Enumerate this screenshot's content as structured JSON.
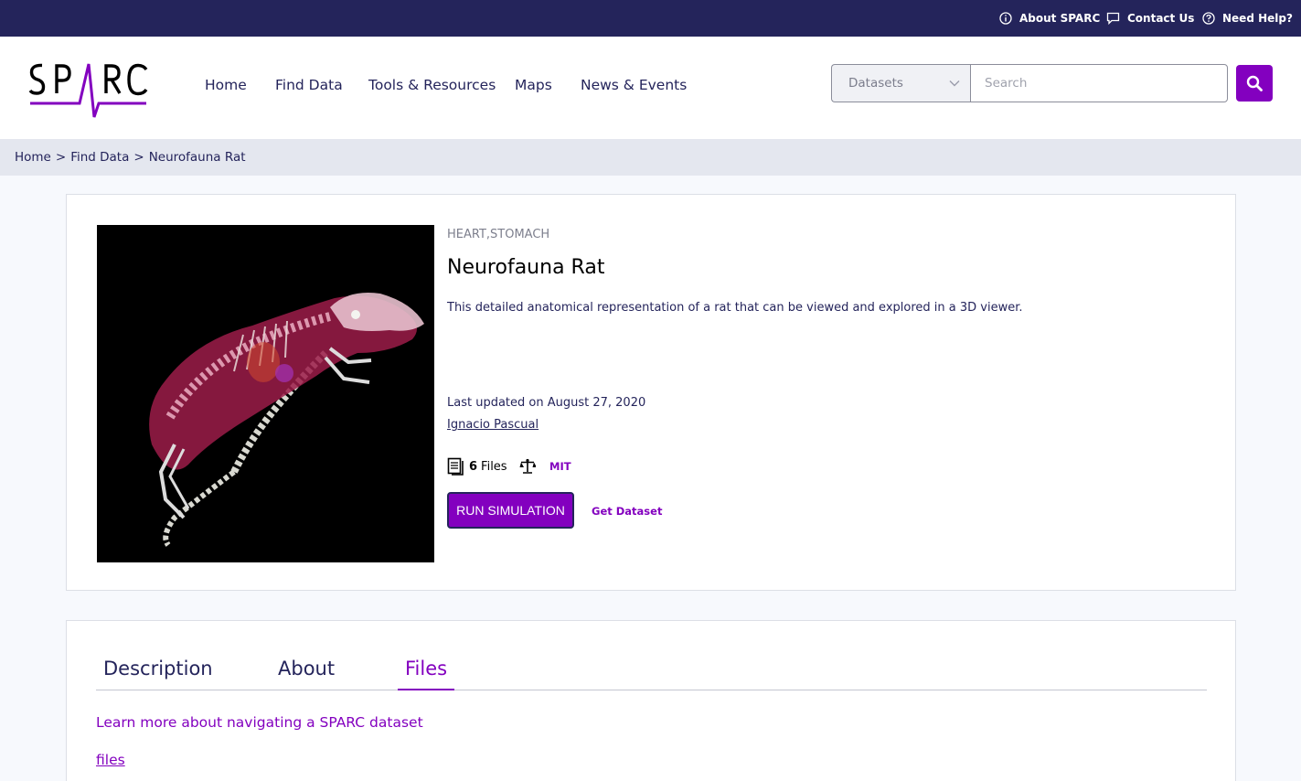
{
  "topbar": {
    "about": "About SPARC",
    "contact": "Contact Us",
    "help": "Need Help?"
  },
  "header": {
    "logo_text": "SPARC",
    "nav": [
      "Home",
      "Find Data",
      "Tools & Resources",
      "Maps",
      "News & Events"
    ],
    "search": {
      "type_selected": "Datasets",
      "placeholder": "Search"
    }
  },
  "breadcrumb": {
    "items": [
      "Home",
      "Find Data",
      "Neurofauna Rat"
    ],
    "separator": ">"
  },
  "dataset": {
    "organs": "HEART,STOMACH",
    "title": "Neurofauna Rat",
    "description": "This detailed anatomical representation of a rat that can be viewed and explored in a 3D viewer.",
    "updated": "Last updated on August 27, 2020",
    "author": "Ignacio Pascual",
    "file_count": "6",
    "files_label": "Files",
    "license": "MIT",
    "run_button": "RUN SIMULATION",
    "get_dataset": "Get Dataset"
  },
  "tabs": {
    "items": [
      "Description",
      "About",
      "Files"
    ],
    "active": "Files"
  },
  "files_section": {
    "learn_more": "Learn more about navigating a SPARC dataset",
    "files_link": "files"
  },
  "colors": {
    "primary": "#8300bf",
    "navy": "#24245b",
    "breadcrumb_bg": "#e4e7ef"
  }
}
